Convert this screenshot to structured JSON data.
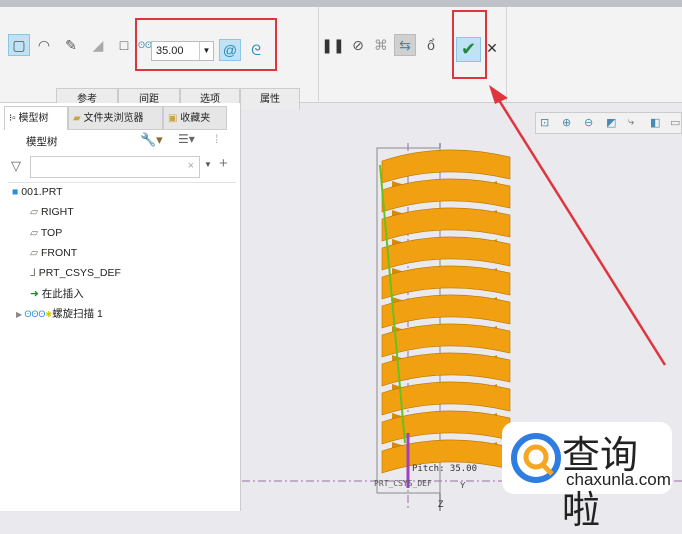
{
  "ribbon": {
    "pitch_value": "35.00",
    "sub_tabs": [
      "参考",
      "间距",
      "选项",
      "属性"
    ],
    "icons": [
      "solid-icon",
      "surface-icon",
      "sketch-icon",
      "remove-material-icon",
      "thin-icon",
      "pitch-icon",
      "right-hand-icon",
      "left-hand-icon",
      "pause-icon",
      "no-preview-icon",
      "preview-icon",
      "verify-icon",
      "glasses-icon",
      "ok-check-icon",
      "cancel-icon"
    ]
  },
  "panel": {
    "tabs": [
      "模型树",
      "文件夹浏览器",
      "收藏夹"
    ],
    "title": "模型树",
    "filter_placeholder": "",
    "tree": [
      {
        "label": "001.PRT",
        "icon": "part-icon"
      },
      {
        "label": "RIGHT",
        "icon": "datum-plane-icon"
      },
      {
        "label": "TOP",
        "icon": "datum-plane-icon"
      },
      {
        "label": "FRONT",
        "icon": "datum-plane-icon"
      },
      {
        "label": "PRT_CSYS_DEF",
        "icon": "csys-icon"
      },
      {
        "label": "在此插入",
        "icon": "insert-arrow-icon"
      },
      {
        "label": "螺旋扫描 1",
        "icon": "helical-sweep-icon"
      }
    ]
  },
  "viewport": {
    "pitch_label": "Pitch: 35.00",
    "csys_label": "PRT_CSYS_DEF",
    "axis_y": "Y",
    "axis_z": "Z"
  },
  "watermark": {
    "brand": "查询啦",
    "url": "chaxunla.com"
  },
  "colors": {
    "spring": "#f0a010",
    "highlight": "#d9363e",
    "accent": "#bfe3f5"
  }
}
